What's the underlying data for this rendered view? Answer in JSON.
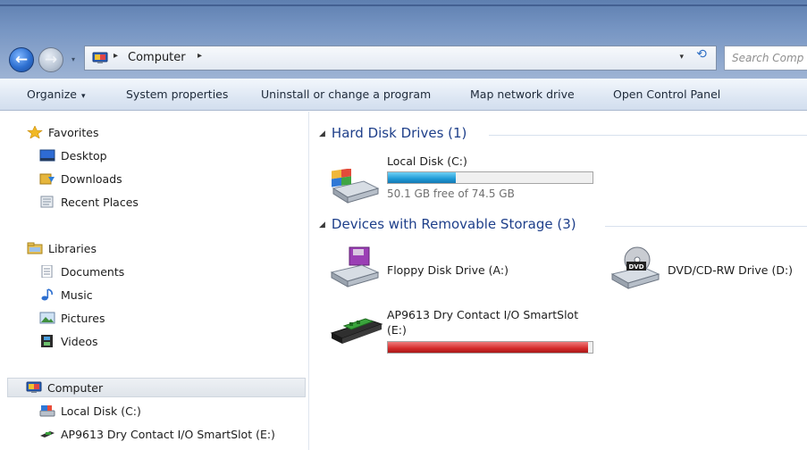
{
  "address_bar": {
    "segments": [
      "Computer"
    ],
    "separator": "▸",
    "dropdown_glyph": "▾",
    "refresh_glyph": "⟲",
    "search_placeholder": "Search Comp"
  },
  "nav_buttons": {
    "back_glyph": "←",
    "forward_glyph": "→",
    "history_glyph": "▾"
  },
  "command_bar": {
    "organize": "Organize",
    "organize_caret": "▾",
    "system_properties": "System properties",
    "uninstall": "Uninstall or change a program",
    "map_drive": "Map network drive",
    "control_panel": "Open Control Panel"
  },
  "nav_pane": {
    "favorites": {
      "label": "Favorites",
      "icon": "star-icon",
      "items": [
        {
          "label": "Desktop",
          "icon": "desktop-icon"
        },
        {
          "label": "Downloads",
          "icon": "downloads-icon"
        },
        {
          "label": "Recent Places",
          "icon": "recent-places-icon"
        }
      ]
    },
    "libraries": {
      "label": "Libraries",
      "icon": "libraries-icon",
      "items": [
        {
          "label": "Documents",
          "icon": "documents-icon"
        },
        {
          "label": "Music",
          "icon": "music-icon"
        },
        {
          "label": "Pictures",
          "icon": "pictures-icon"
        },
        {
          "label": "Videos",
          "icon": "videos-icon"
        }
      ]
    },
    "computer": {
      "label": "Computer",
      "icon": "computer-icon",
      "items": [
        {
          "label": "Local Disk (C:)",
          "icon": "local-disk-icon"
        },
        {
          "label": "AP9613 Dry Contact I/O SmartSlot (E:)",
          "icon": "smartslot-icon"
        }
      ]
    }
  },
  "content": {
    "hard_disk_header": "Hard Disk Drives (1)",
    "removable_header": "Devices with Removable Storage (3)",
    "drives": {
      "c": {
        "name": "Local Disk (C:)",
        "free_text": "50.1 GB free of 74.5 GB",
        "used_fraction": 0.33,
        "bar_color": "#1f9ad6"
      },
      "a": {
        "name": "Floppy Disk Drive (A:)"
      },
      "d": {
        "name": "DVD/CD-RW Drive (D:)",
        "label": "DVD"
      },
      "e": {
        "name_line1": "AP9613 Dry Contact I/O SmartSlot",
        "name_line2": "(E:)",
        "used_fraction": 0.98,
        "bar_color": "#d42b2b"
      }
    }
  },
  "colors": {
    "group_header": "#1e3f8a",
    "selection": "#dfe4ea"
  }
}
